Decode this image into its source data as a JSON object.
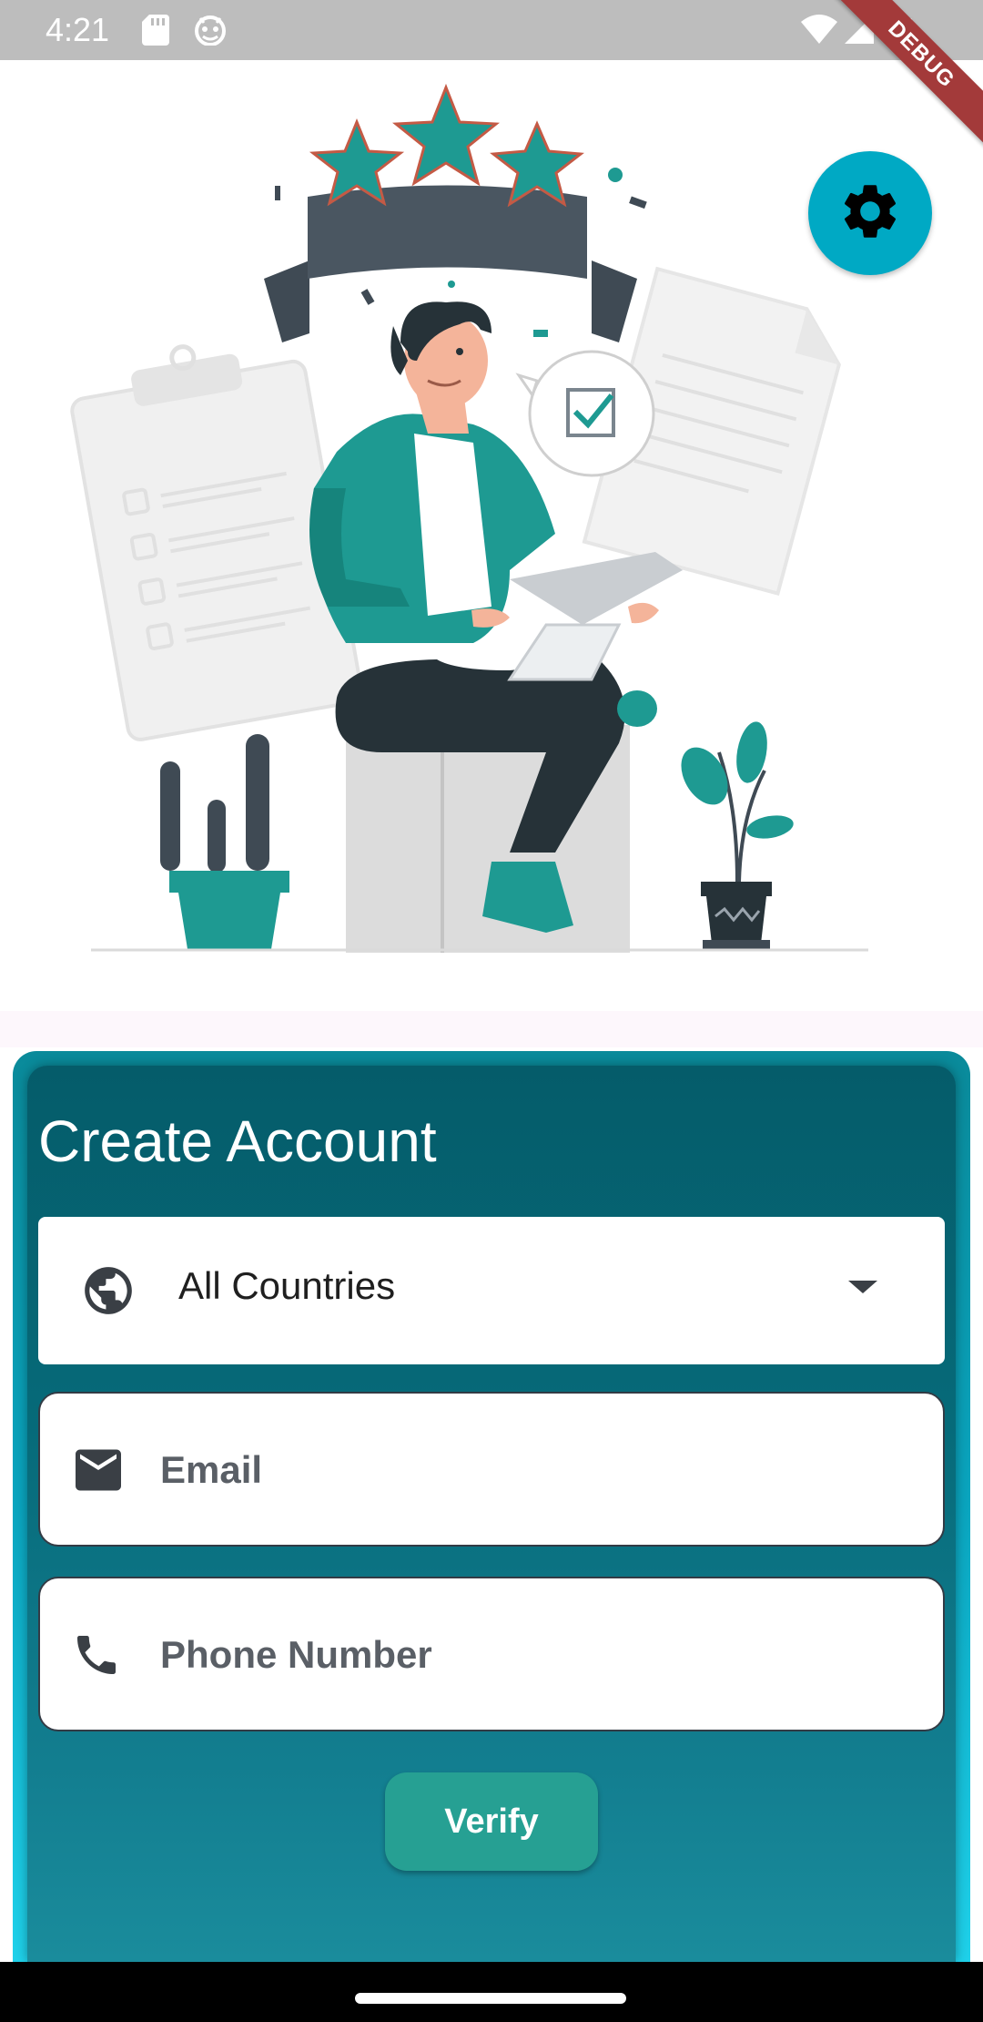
{
  "status_bar": {
    "time": "4:21",
    "icons": [
      "sd-card-icon",
      "android-debug-icon",
      "wifi-icon",
      "signal-icon",
      "battery-icon"
    ]
  },
  "debug_banner": "DEBUG",
  "settings_button": {
    "icon": "gear-icon"
  },
  "form": {
    "title": "Create Account",
    "country_select": {
      "icon": "globe-icon",
      "value": "All Countries"
    },
    "email": {
      "icon": "mail-icon",
      "placeholder": "Email",
      "value": ""
    },
    "phone": {
      "icon": "phone-icon",
      "placeholder": "Phone Number",
      "value": ""
    },
    "verify_label": "Verify"
  },
  "colors": {
    "accent": "#26A093",
    "fab": "#00A9C4",
    "card_dark": "#066A79",
    "illustration_teal": "#1E9A92",
    "illustration_dark": "#3F4A54"
  }
}
